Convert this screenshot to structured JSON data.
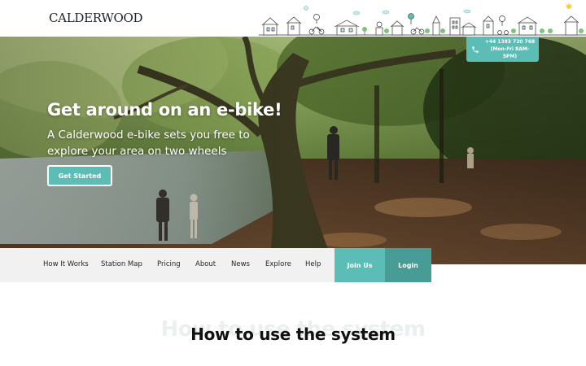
{
  "header": {
    "logo": "CALDERWOOD",
    "phone": "+44 1383 720 768",
    "hours": "(Mon-Fri 8AM-5PM)"
  },
  "hero": {
    "title": "Get around on an e-bike!",
    "subtitle": "A Calderwood e-bike sets you free to explore your area on two wheels",
    "cta_label": "Get Started"
  },
  "nav": {
    "items": [
      {
        "label": "How It Works"
      },
      {
        "label": "Station Map"
      },
      {
        "label": "Pricing"
      },
      {
        "label": "About"
      },
      {
        "label": "News"
      },
      {
        "label": "Explore"
      },
      {
        "label": "Help"
      }
    ],
    "join_label": "Join Us",
    "login_label": "Login"
  },
  "section": {
    "ghost_title": "How to use the system",
    "title": "How to use the system"
  },
  "colors": {
    "accent": "#5cbdb6",
    "accent_dark": "#479c95",
    "nav_bg": "#f1f1f1",
    "text": "#1f2326"
  },
  "icons": {
    "phone": "phone-icon",
    "skyline": "skyline-illustration"
  }
}
